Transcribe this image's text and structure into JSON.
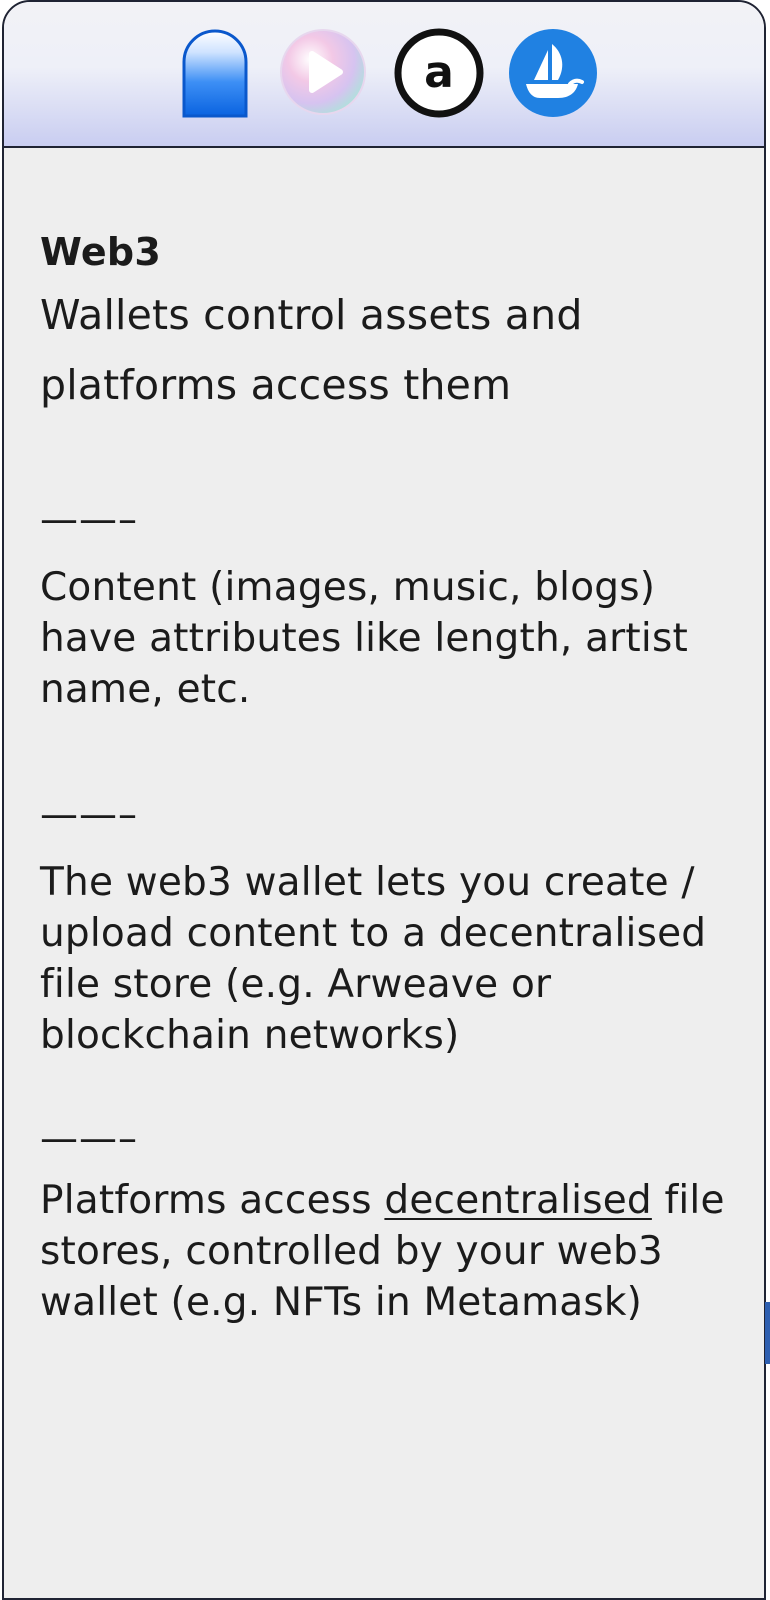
{
  "header": {
    "icons": [
      {
        "name": "phone-capsule-icon",
        "color": "#1a7ff0"
      },
      {
        "name": "play-bubble-icon",
        "color": "#f5b6dc"
      },
      {
        "name": "arweave-icon",
        "letter": "a",
        "color": "#111111"
      },
      {
        "name": "opensea-icon",
        "color": "#2081e2"
      }
    ]
  },
  "card": {
    "title": "Web3",
    "subtitle_line1": "Wallets control assets and",
    "subtitle_line2": "platforms access them",
    "separator": "——–",
    "section1": {
      "separator": "——–",
      "text": "Content (images, music, blogs) have attributes like length, artist name, etc."
    },
    "section2": {
      "separator": "——–",
      "text": "The web3 wallet lets you create / upload content to a decentralised file store (e.g. Arweave or blockchain networks)"
    },
    "section3": {
      "text_before": "Platforms access ",
      "link_text": "decentralised",
      "text_after": " file stores, controlled by your web3 wallet (e.g. NFTs in Metamask)"
    }
  }
}
